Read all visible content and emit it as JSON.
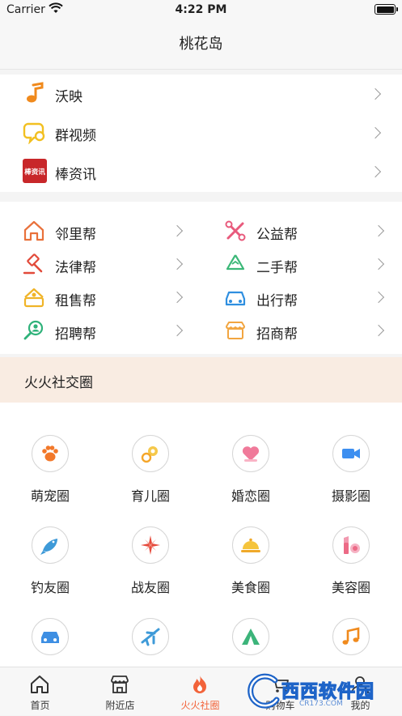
{
  "status_bar": {
    "carrier": "Carrier",
    "time": "4:22 PM"
  },
  "nav": {
    "title": "桃花岛"
  },
  "section_a": {
    "items": [
      {
        "label": "沃映",
        "icon": "music-note-icon"
      },
      {
        "label": "群视频",
        "icon": "video-chat-icon"
      },
      {
        "label": "棒资讯",
        "icon": "news-logo-icon",
        "icon_text": "棒资讯"
      }
    ]
  },
  "section_b": {
    "items": [
      {
        "label": "邻里帮",
        "icon": "house-icon"
      },
      {
        "label": "公益帮",
        "icon": "tools-icon"
      },
      {
        "label": "法律帮",
        "icon": "gavel-icon"
      },
      {
        "label": "二手帮",
        "icon": "recycle-icon"
      },
      {
        "label": "租售帮",
        "icon": "house-rental-icon"
      },
      {
        "label": "出行帮",
        "icon": "car-icon"
      },
      {
        "label": "招聘帮",
        "icon": "magnifier-person-icon"
      },
      {
        "label": "招商帮",
        "icon": "shop-icon"
      }
    ]
  },
  "circles": {
    "title": "火火社交圈",
    "items": [
      {
        "label": "萌宠圈",
        "icon": "paw-icon"
      },
      {
        "label": "育儿圈",
        "icon": "pacifier-icon"
      },
      {
        "label": "婚恋圈",
        "icon": "heart-icon"
      },
      {
        "label": "摄影圈",
        "icon": "camera-icon"
      },
      {
        "label": "钓友圈",
        "icon": "fish-icon"
      },
      {
        "label": "战友圈",
        "icon": "compass-star-icon"
      },
      {
        "label": "美食圈",
        "icon": "food-cloche-icon"
      },
      {
        "label": "美容圈",
        "icon": "lipstick-icon"
      },
      {
        "label": "",
        "icon": "car-icon"
      },
      {
        "label": "",
        "icon": "airplane-icon"
      },
      {
        "label": "",
        "icon": "tent-icon"
      },
      {
        "label": "",
        "icon": "music-notes-icon"
      }
    ]
  },
  "tabs": [
    {
      "label": "首页",
      "icon": "home-icon"
    },
    {
      "label": "附近店",
      "icon": "store-icon"
    },
    {
      "label": "火火社圈",
      "icon": "flame-icon",
      "active": true
    },
    {
      "label": "购物车",
      "icon": "cart-icon"
    },
    {
      "label": "我的",
      "icon": "profile-icon"
    }
  ],
  "watermark": {
    "text": "西西软件园",
    "sub": "CR173.COM"
  },
  "colors": {
    "accent": "#f2633a",
    "circle_header_bg": "#f9ece2"
  }
}
